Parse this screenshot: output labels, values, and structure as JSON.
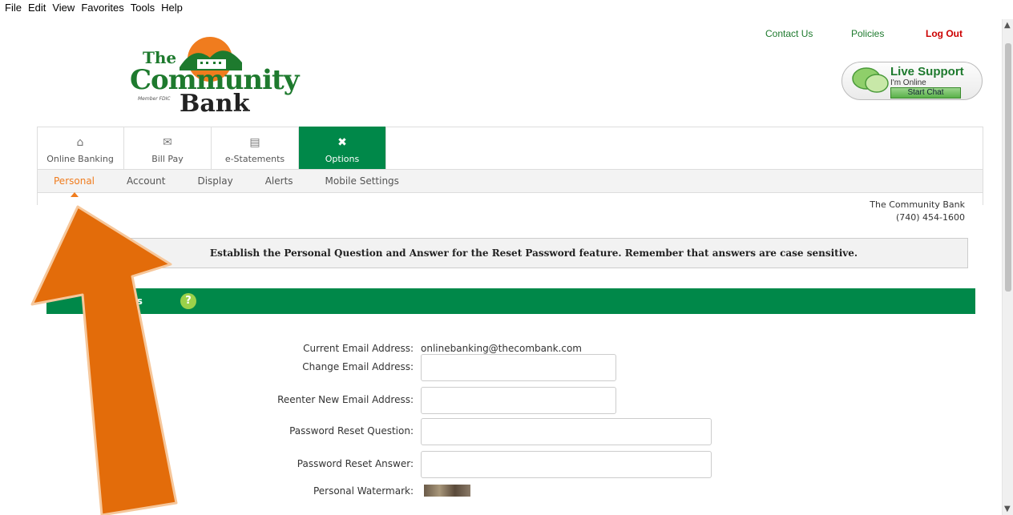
{
  "menubar": [
    "File",
    "Edit",
    "View",
    "Favorites",
    "Tools",
    "Help"
  ],
  "logo": {
    "the": "The",
    "community": "Community",
    "bank": "Bank",
    "fdic": "Member FDIC"
  },
  "toplinks": {
    "contact": "Contact Us",
    "policies": "Policies",
    "logout": "Log Out"
  },
  "support": {
    "title": "Live Support",
    "status": "I'm Online",
    "button": "Start Chat"
  },
  "tabs": [
    {
      "label": "Online Banking",
      "icon": "home-icon"
    },
    {
      "label": "Bill Pay",
      "icon": "bill-icon"
    },
    {
      "label": "e-Statements",
      "icon": "briefcase-icon"
    },
    {
      "label": "Options",
      "icon": "tools-icon"
    }
  ],
  "subnav": [
    "Personal",
    "Account",
    "Display",
    "Alerts",
    "Mobile Settings"
  ],
  "contact": {
    "name": "The Community Bank",
    "phone": "(740) 454-1600"
  },
  "notice": "Establish the Personal Question and Answer for the Reset Password feature. Remember that answers are case sensitive.",
  "section": {
    "title": "ttings",
    "help": "?"
  },
  "form": {
    "current_email_label": "Current Email Address:",
    "current_email_value": "onlinebanking@thecombank.com",
    "change_email_label": "Change Email Address:",
    "reenter_email_label": "Reenter New Email Address:",
    "question_label": "Password Reset Question:",
    "answer_label": "Password Reset Answer:",
    "watermark_label": "Personal Watermark:"
  },
  "colors": {
    "brand_green": "#008849",
    "accent_orange": "#f07c1e",
    "logout_red": "#cc0000",
    "arrow_orange": "#e36c0a"
  }
}
